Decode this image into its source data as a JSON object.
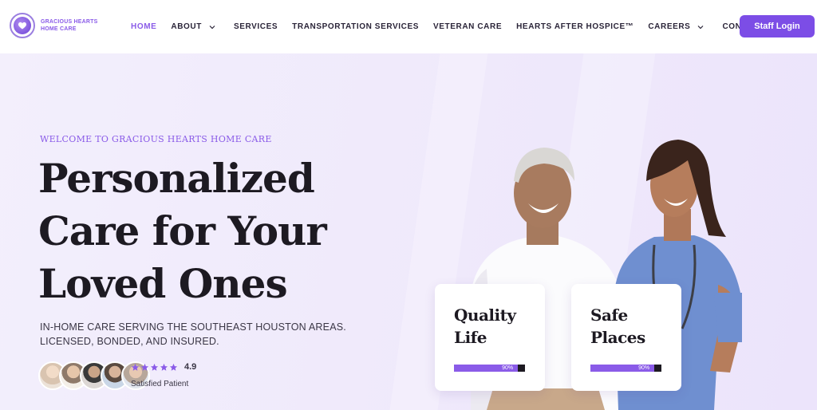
{
  "brand": {
    "name_line1": "GRACIOUS HEARTS",
    "name_line2": "HOME CARE",
    "accent_color": "#8a5be8",
    "button_color": "#7c4de6"
  },
  "nav": {
    "items": [
      {
        "label": "HOME",
        "active": true,
        "has_dropdown": false
      },
      {
        "label": "ABOUT",
        "active": false,
        "has_dropdown": true
      },
      {
        "label": "SERVICES",
        "active": false,
        "has_dropdown": false
      },
      {
        "label": "TRANSPORTATION SERVICES",
        "active": false,
        "has_dropdown": false
      },
      {
        "label": "VETERAN CARE",
        "active": false,
        "has_dropdown": false
      },
      {
        "label": "HEARTS AFTER HOSPICE™",
        "active": false,
        "has_dropdown": false
      },
      {
        "label": "CAREERS",
        "active": false,
        "has_dropdown": true
      },
      {
        "label": "CONTACT US",
        "active": false,
        "has_dropdown": false
      }
    ],
    "login_label": "Staff Login"
  },
  "hero": {
    "welcome": "WELCOME TO GRACIOUS HEARTS HOME CARE",
    "headline": [
      "Personalized",
      "Care for Your",
      "Loved Ones"
    ],
    "sub_line1": "IN-HOME CARE SERVING THE SOUTHEAST HOUSTON AREAS.",
    "sub_line2": "LICENSED, BONDED, AND INSURED.",
    "rating_value": "4.9",
    "star_count": 5,
    "satisfied_label": "Satisfied Patient"
  },
  "cards": [
    {
      "title_line1": "Quality",
      "title_line2": "Life",
      "percent_label": "90%",
      "percent": 90
    },
    {
      "title_line1": "Safe",
      "title_line2": "Places",
      "percent_label": "90%",
      "percent": 90
    }
  ]
}
